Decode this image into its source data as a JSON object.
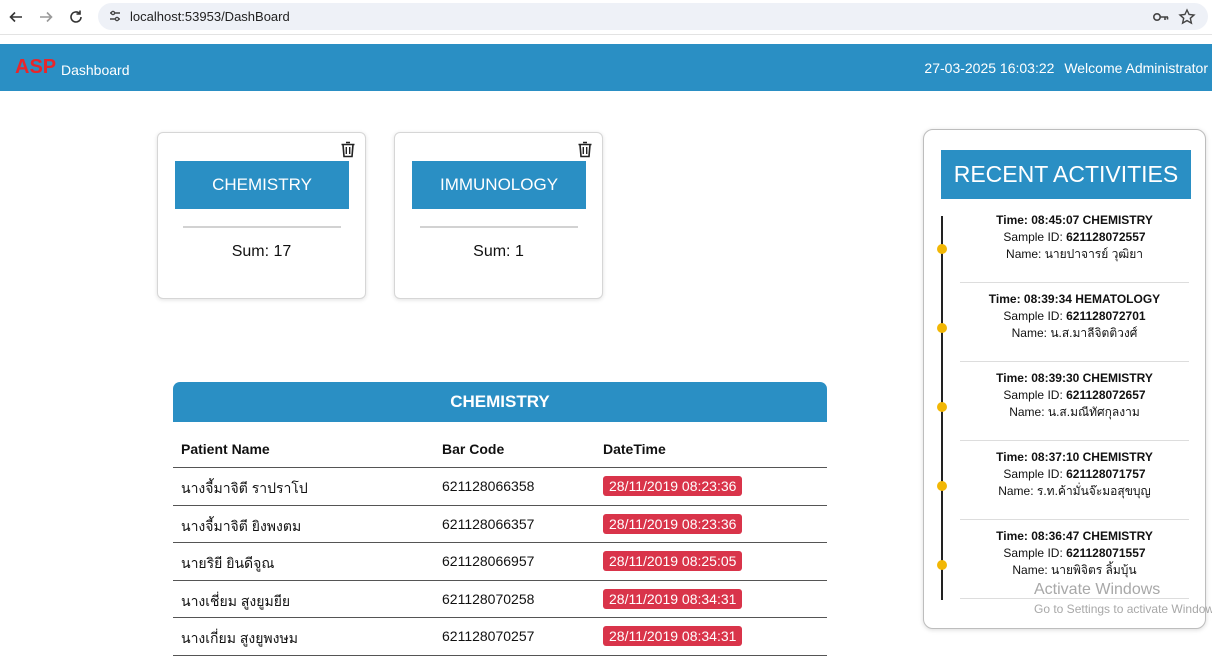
{
  "browser": {
    "url": "localhost:53953/DashBoard"
  },
  "header": {
    "brand": "ASP",
    "subtitle": "Dashboard",
    "datetime": "27-03-2025 16:03:22",
    "welcome": "Welcome Administrator"
  },
  "cards": [
    {
      "title": "CHEMISTRY",
      "sum": "Sum: 17"
    },
    {
      "title": "IMMUNOLOGY",
      "sum": "Sum: 1"
    }
  ],
  "table": {
    "title": "CHEMISTRY",
    "headers": {
      "name": "Patient Name",
      "barcode": "Bar Code",
      "datetime": "DateTime"
    },
    "rows": [
      {
        "name": "นางจี้มาจิตี ราปราโป",
        "barcode": "621128066358",
        "datetime": "28/11/2019 08:23:36"
      },
      {
        "name": "นางจี้มาจิตี ยิงพงตม",
        "barcode": "621128066357",
        "datetime": "28/11/2019 08:23:36"
      },
      {
        "name": "นายริยี ยินดีจูณ",
        "barcode": "621128066957",
        "datetime": "28/11/2019 08:25:05"
      },
      {
        "name": "นางเชี่ยม สูงยูมยีย",
        "barcode": "621128070258",
        "datetime": "28/11/2019 08:34:31"
      },
      {
        "name": "นางเกี่ยม สูงยูพงษม",
        "barcode": "621128070257",
        "datetime": "28/11/2019 08:34:31"
      }
    ]
  },
  "activities": {
    "title": "RECENT ACTIVITIES",
    "items": [
      {
        "time": "Time: 08:45:07 CHEMISTRY",
        "sample_label": "Sample ID:",
        "sample_id": "621128072557",
        "name": "Name: นายปาจารย์ วุฒิยา"
      },
      {
        "time": "Time: 08:39:34 HEMATOLOGY",
        "sample_label": "Sample ID:",
        "sample_id": "621128072701",
        "name": "Name: น.ส.มาลีจิตติวงศ์"
      },
      {
        "time": "Time: 08:39:30 CHEMISTRY",
        "sample_label": "Sample ID:",
        "sample_id": "621128072657",
        "name": "Name: น.ส.มณีทัศกุลงาม"
      },
      {
        "time": "Time: 08:37:10 CHEMISTRY",
        "sample_label": "Sample ID:",
        "sample_id": "621128071757",
        "name": "Name: ร.ท.ค้ามั่นจ๊ะมอสุขบุญ"
      },
      {
        "time": "Time: 08:36:47 CHEMISTRY",
        "sample_label": "Sample ID:",
        "sample_id": "621128071557",
        "name": "Name: นายพิจิตร ลิ้มบุ้น"
      }
    ]
  },
  "watermark": {
    "line1": "Activate Windows",
    "line2": "Go to Settings to activate Windows."
  },
  "colors": {
    "primary": "#2a8fc4",
    "brand_red": "#e8262b",
    "badge_red": "#d9344a",
    "timeline_dot": "#f2b705"
  }
}
